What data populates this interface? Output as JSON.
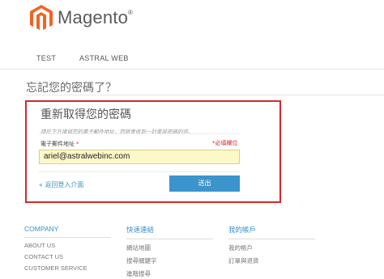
{
  "brand": {
    "name": "Magento",
    "mark": "®",
    "accent": "#f26322"
  },
  "nav": {
    "items": [
      "TEST",
      "ASTRAL WEB"
    ]
  },
  "page": {
    "title": "忘記您的密碼了？"
  },
  "form": {
    "section_title": "重新取得您的密碼",
    "hint": "請於下方填寫您的電子郵件地址，您將會收到一封重設密碼的信。",
    "email_label": "電子郵件地址",
    "required_star": "*",
    "required_note": "*必填欄位",
    "email_value": "ariel@astralwebinc.com",
    "back_link": "« 返回登入介面",
    "submit_label": "送出"
  },
  "footer": {
    "columns": [
      {
        "heading": "COMPANY",
        "links": [
          "ABOUT US",
          "CONTACT US",
          "CUSTOMER SERVICE"
        ]
      },
      {
        "heading": "快速連結",
        "links": [
          "網站地圖",
          "搜尋關鍵字",
          "進階搜尋"
        ]
      },
      {
        "heading": "我的帳戶",
        "links": [
          "我的帳戶",
          "訂單與退貨"
        ]
      }
    ]
  },
  "colors": {
    "highlight_border": "#d0292f",
    "link": "#3a91c6",
    "button": "#3b95cc",
    "input_bg": "#fdf8c8"
  }
}
